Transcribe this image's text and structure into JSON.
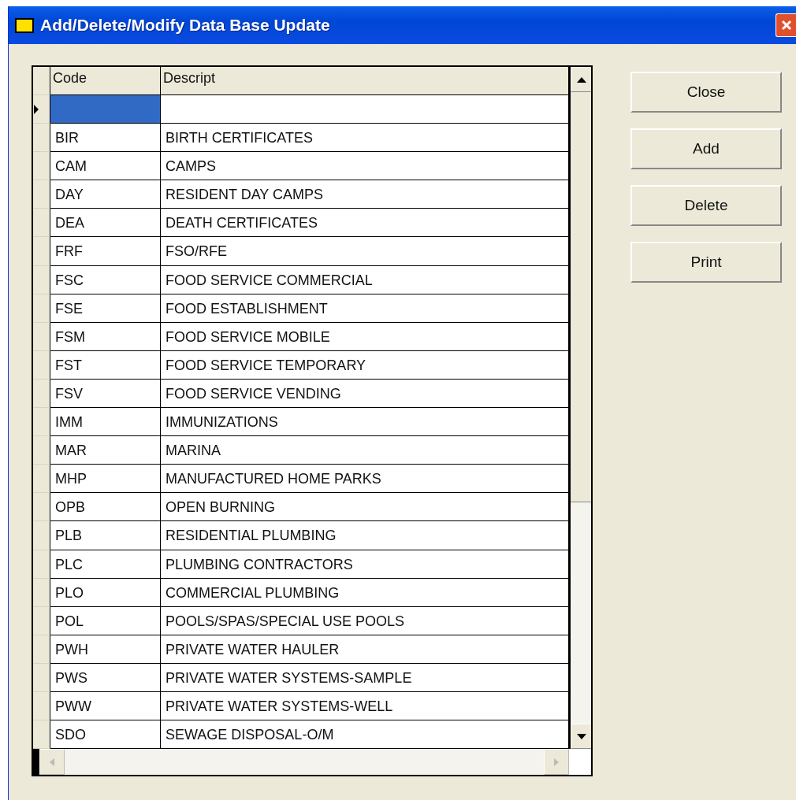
{
  "window": {
    "title": "Add/Delete/Modify Data Base Update"
  },
  "table": {
    "columns": [
      "Code",
      "Descript"
    ],
    "rows": [
      {
        "code": "",
        "descript": "",
        "selected": true
      },
      {
        "code": "BIR",
        "descript": "BIRTH CERTIFICATES",
        "selected": false
      },
      {
        "code": "CAM",
        "descript": "CAMPS",
        "selected": false
      },
      {
        "code": "DAY",
        "descript": "RESIDENT DAY CAMPS",
        "selected": false
      },
      {
        "code": "DEA",
        "descript": "DEATH CERTIFICATES",
        "selected": false
      },
      {
        "code": "FRF",
        "descript": "FSO/RFE",
        "selected": false
      },
      {
        "code": "FSC",
        "descript": "FOOD SERVICE COMMERCIAL",
        "selected": false
      },
      {
        "code": "FSE",
        "descript": "FOOD ESTABLISHMENT",
        "selected": false
      },
      {
        "code": "FSM",
        "descript": "FOOD SERVICE MOBILE",
        "selected": false
      },
      {
        "code": "FST",
        "descript": "FOOD SERVICE TEMPORARY",
        "selected": false
      },
      {
        "code": "FSV",
        "descript": "FOOD SERVICE VENDING",
        "selected": false
      },
      {
        "code": "IMM",
        "descript": "IMMUNIZATIONS",
        "selected": false
      },
      {
        "code": "MAR",
        "descript": "MARINA",
        "selected": false
      },
      {
        "code": "MHP",
        "descript": "MANUFACTURED HOME PARKS",
        "selected": false
      },
      {
        "code": "OPB",
        "descript": "OPEN BURNING",
        "selected": false
      },
      {
        "code": "PLB",
        "descript": "RESIDENTIAL PLUMBING",
        "selected": false
      },
      {
        "code": "PLC",
        "descript": "PLUMBING CONTRACTORS",
        "selected": false
      },
      {
        "code": "PLO",
        "descript": "COMMERCIAL PLUMBING",
        "selected": false
      },
      {
        "code": "POL",
        "descript": "POOLS/SPAS/SPECIAL USE POOLS",
        "selected": false
      },
      {
        "code": "PWH",
        "descript": "PRIVATE WATER HAULER",
        "selected": false
      },
      {
        "code": "PWS",
        "descript": "PRIVATE WATER SYSTEMS-SAMPLE",
        "selected": false
      },
      {
        "code": "PWW",
        "descript": "PRIVATE WATER SYSTEMS-WELL",
        "selected": false
      },
      {
        "code": "SDO",
        "descript": "SEWAGE DISPOSAL-O/M",
        "selected": false
      }
    ]
  },
  "buttons": [
    "Close",
    "Add",
    "Delete",
    "Print"
  ]
}
